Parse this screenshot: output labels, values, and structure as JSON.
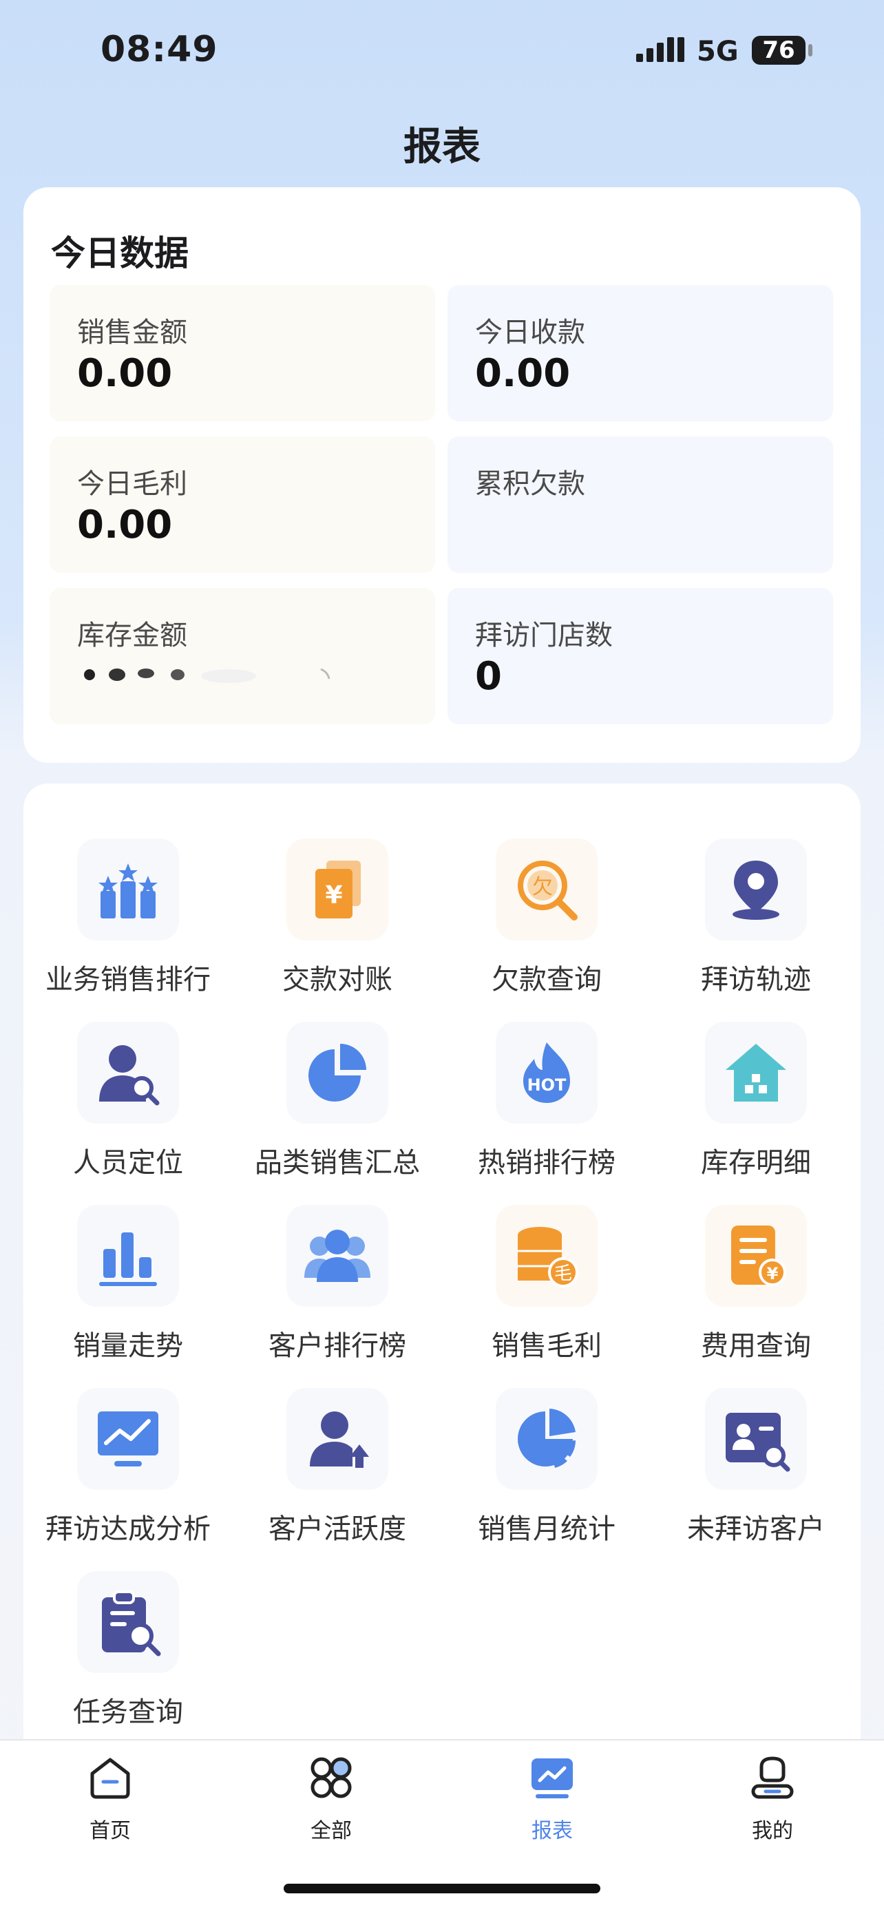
{
  "status_bar": {
    "time": "08:49",
    "network": "5G",
    "battery": "76"
  },
  "page_title": "报表",
  "today": {
    "title": "今日数据",
    "tiles": [
      {
        "label": "销售金额",
        "value": "0.00"
      },
      {
        "label": "今日收款",
        "value": "0.00"
      },
      {
        "label": "今日毛利",
        "value": "0.00"
      },
      {
        "label": "累积欠款",
        "value": ""
      },
      {
        "label": "库存金额",
        "value": ""
      },
      {
        "label": "拜访门店数",
        "value": "0"
      }
    ]
  },
  "menu": {
    "items": [
      {
        "label": "业务销售排行",
        "icon": "ranking-bars-icon"
      },
      {
        "label": "交款对账",
        "icon": "payment-bill-icon"
      },
      {
        "label": "欠款查询",
        "icon": "debt-search-icon"
      },
      {
        "label": "拜访轨迹",
        "icon": "location-pin-icon"
      },
      {
        "label": "人员定位",
        "icon": "person-search-icon"
      },
      {
        "label": "品类销售汇总",
        "icon": "pie-chart-icon"
      },
      {
        "label": "热销排行榜",
        "icon": "hot-flame-icon"
      },
      {
        "label": "库存明细",
        "icon": "warehouse-icon"
      },
      {
        "label": "销量走势",
        "icon": "bar-chart-icon"
      },
      {
        "label": "客户排行榜",
        "icon": "customers-icon"
      },
      {
        "label": "销售毛利",
        "icon": "coin-stack-icon"
      },
      {
        "label": "费用查询",
        "icon": "expense-doc-icon"
      },
      {
        "label": "拜访达成分析",
        "icon": "trend-board-icon"
      },
      {
        "label": "客户活跃度",
        "icon": "customer-activity-icon"
      },
      {
        "label": "销售月统计",
        "icon": "monthly-pie-icon"
      },
      {
        "label": "未拜访客户",
        "icon": "contact-card-search-icon"
      },
      {
        "label": "任务查询",
        "icon": "task-clipboard-icon"
      }
    ]
  },
  "tabbar": {
    "tabs": [
      {
        "label": "首页",
        "icon": "home-icon"
      },
      {
        "label": "全部",
        "icon": "all-grid-icon"
      },
      {
        "label": "报表",
        "icon": "report-icon",
        "active": true
      },
      {
        "label": "我的",
        "icon": "profile-icon"
      }
    ],
    "active_color": "#4f86e8"
  }
}
